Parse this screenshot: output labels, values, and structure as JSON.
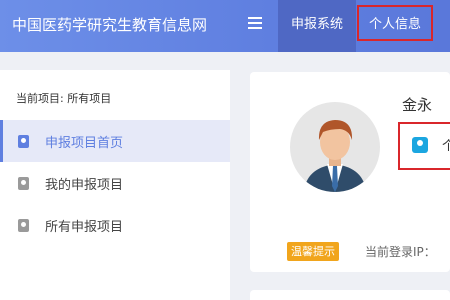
{
  "header": {
    "site_title": "中国医药学研究生教育信息网",
    "menu_icon": "hamburger-icon",
    "tabs": [
      {
        "label": "申报系统",
        "active": true
      },
      {
        "label": "个人信息",
        "active": false,
        "highlighted": true
      }
    ],
    "colors": {
      "bar": "#6d8fe8",
      "active_tab": "#4f68c4",
      "highlight": "#d9262b"
    }
  },
  "sidebar": {
    "current_project": "当前项目: 所有项目",
    "items": [
      {
        "label": "申报项目首页",
        "icon": "user-card-icon",
        "active": true
      },
      {
        "label": "我的申报项目",
        "icon": "user-card-icon",
        "active": false
      },
      {
        "label": "所有申报项目",
        "icon": "user-card-icon",
        "active": false
      }
    ]
  },
  "profile": {
    "avatar": "user-avatar",
    "name": "金永",
    "link_icon": "person-icon",
    "link_text": "个",
    "tip_badge": "温馨提示",
    "login_ip_label": "当前登录IP："
  }
}
